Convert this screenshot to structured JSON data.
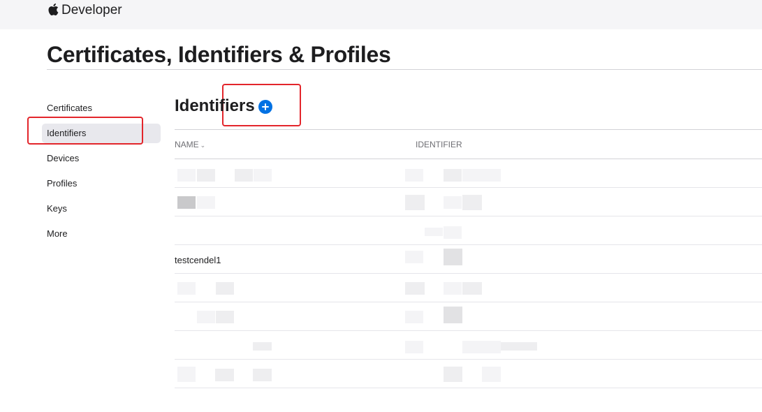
{
  "header": {
    "brand": "Developer",
    "logo_icon": "apple-icon"
  },
  "page": {
    "title": "Certificates, Identifiers & Profiles"
  },
  "sidebar": {
    "items": [
      {
        "label": "Certificates",
        "active": false
      },
      {
        "label": "Identifiers",
        "active": true
      },
      {
        "label": "Devices",
        "active": false
      },
      {
        "label": "Profiles",
        "active": false
      },
      {
        "label": "Keys",
        "active": false
      },
      {
        "label": "More",
        "active": false
      }
    ]
  },
  "section": {
    "title": "Identifiers",
    "add_icon": "plus-circle-icon"
  },
  "table": {
    "columns": [
      "NAME",
      "IDENTIFIER"
    ],
    "sort_icon": "chevron-down-icon",
    "rows": [
      {
        "name": "",
        "identifier": ""
      },
      {
        "name": "",
        "identifier": ""
      },
      {
        "name": "",
        "identifier": ""
      },
      {
        "name": "testcendel1",
        "identifier": ""
      },
      {
        "name": "",
        "identifier": ""
      },
      {
        "name": "",
        "identifier": ""
      },
      {
        "name": "",
        "identifier": ""
      },
      {
        "name": "",
        "identifier": ""
      }
    ]
  },
  "annotations": {
    "highlight_color": "#e3252b",
    "accent_color": "#0071e3"
  }
}
